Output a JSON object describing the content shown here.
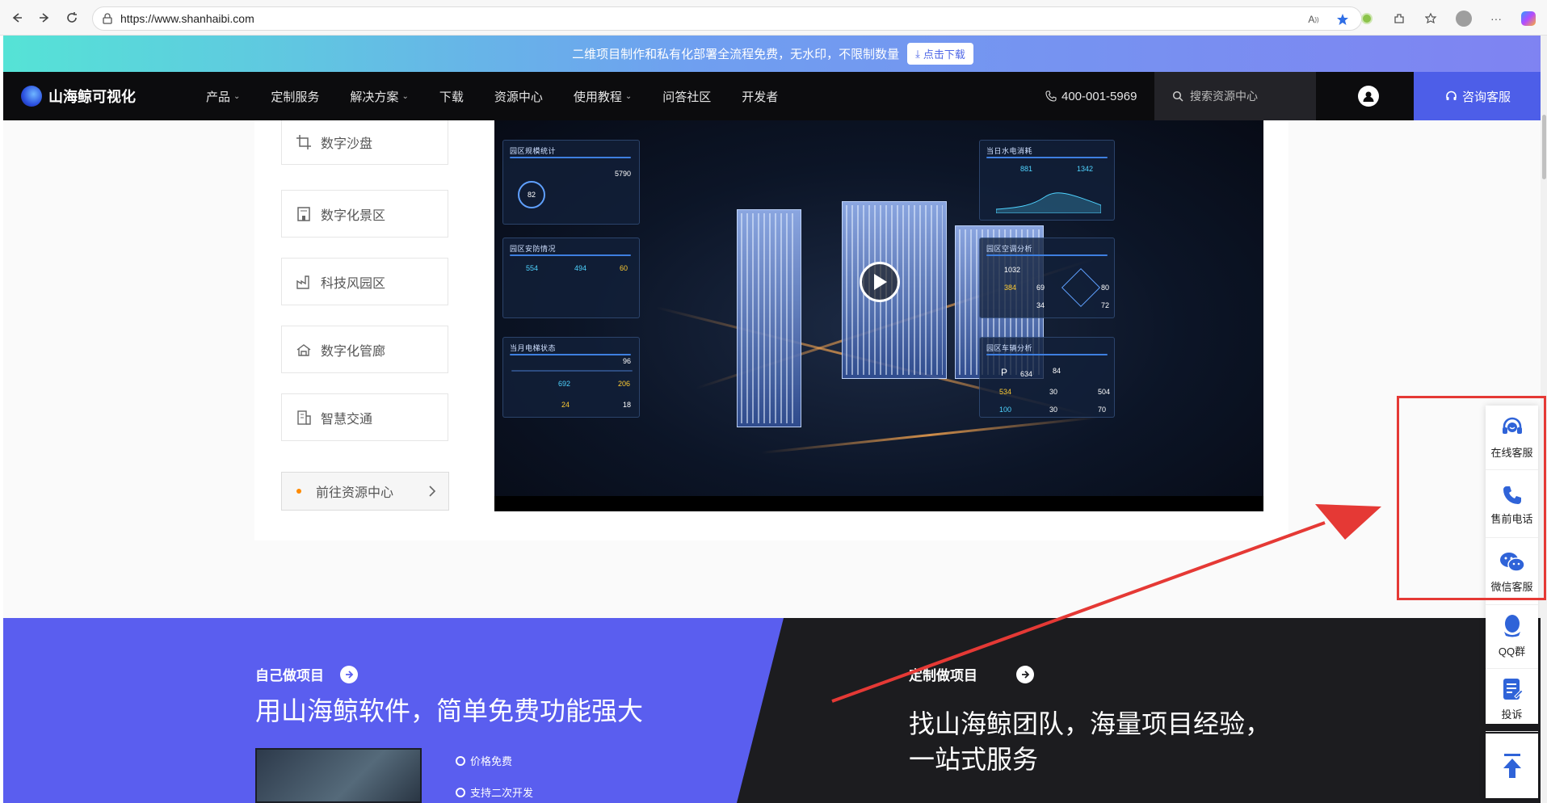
{
  "browser": {
    "url": "https://www.shanhaibi.com"
  },
  "promo": {
    "text": "二维项目制作和私有化部署全流程免费，无水印，不限制数量",
    "button": "点击下载"
  },
  "nav": {
    "logo": "山海鲸可视化",
    "items": [
      {
        "label": "产品",
        "dropdown": true
      },
      {
        "label": "定制服务",
        "dropdown": false
      },
      {
        "label": "解决方案",
        "dropdown": true
      },
      {
        "label": "下载",
        "dropdown": false
      },
      {
        "label": "资源中心",
        "dropdown": false
      },
      {
        "label": "使用教程",
        "dropdown": true
      },
      {
        "label": "问答社区",
        "dropdown": false
      },
      {
        "label": "开发者",
        "dropdown": false
      }
    ],
    "phone": "400-001-5969",
    "search_placeholder": "搜索资源中心",
    "consult": "咨询客服"
  },
  "solutions": {
    "items": [
      {
        "label": "数字沙盘",
        "icon": "crop-icon"
      },
      {
        "label": "数字化景区",
        "icon": "building-icon"
      },
      {
        "label": "科技风园区",
        "icon": "factory-icon"
      },
      {
        "label": "数字化管廊",
        "icon": "pipe-icon"
      },
      {
        "label": "智慧交通",
        "icon": "traffic-icon"
      }
    ],
    "goto_label": "前往资源中心"
  },
  "video": {
    "panels": {
      "park_scale": "园区规模统计",
      "park_scale_value": "5790",
      "power": "当日水电消耗",
      "power_value_a": "881",
      "power_value_b": "1342",
      "security": "园区安防情况",
      "security_values": [
        "554",
        "494",
        "60"
      ],
      "air": "园区空调分析",
      "air_values": [
        "1032",
        "384",
        "69",
        "80",
        "34",
        "72"
      ],
      "elevator": "当月电梯状态",
      "elevator_values": [
        "96",
        "692",
        "206",
        "24",
        "18"
      ],
      "vehicle": "园区车辆分析",
      "vehicle_values": [
        "634",
        "84",
        "534",
        "30",
        "504",
        "100",
        "30",
        "70"
      ],
      "gauge": "82"
    }
  },
  "bottom": {
    "left_label": "自己做项目",
    "left_title": "用山海鲸软件，简单免费功能强大",
    "features": [
      "价格免费",
      "支持二次开发"
    ],
    "right_label": "定制做项目",
    "right_title_1": "找山海鲸团队，海量项目经验，",
    "right_title_2": "一站式服务"
  },
  "float_menu": {
    "items": [
      {
        "label": "在线客服",
        "icon": "headset-icon"
      },
      {
        "label": "售前电话",
        "icon": "phone-icon"
      },
      {
        "label": "微信客服",
        "icon": "wechat-icon"
      },
      {
        "label": "QQ群",
        "icon": "qq-icon"
      },
      {
        "label": "投诉",
        "icon": "complaint-icon"
      }
    ]
  },
  "colors": {
    "accent": "#4d5ee8",
    "bottom_left": "#5a5eef",
    "bottom_right": "#1c1c1f",
    "annotation": "#e53935"
  }
}
